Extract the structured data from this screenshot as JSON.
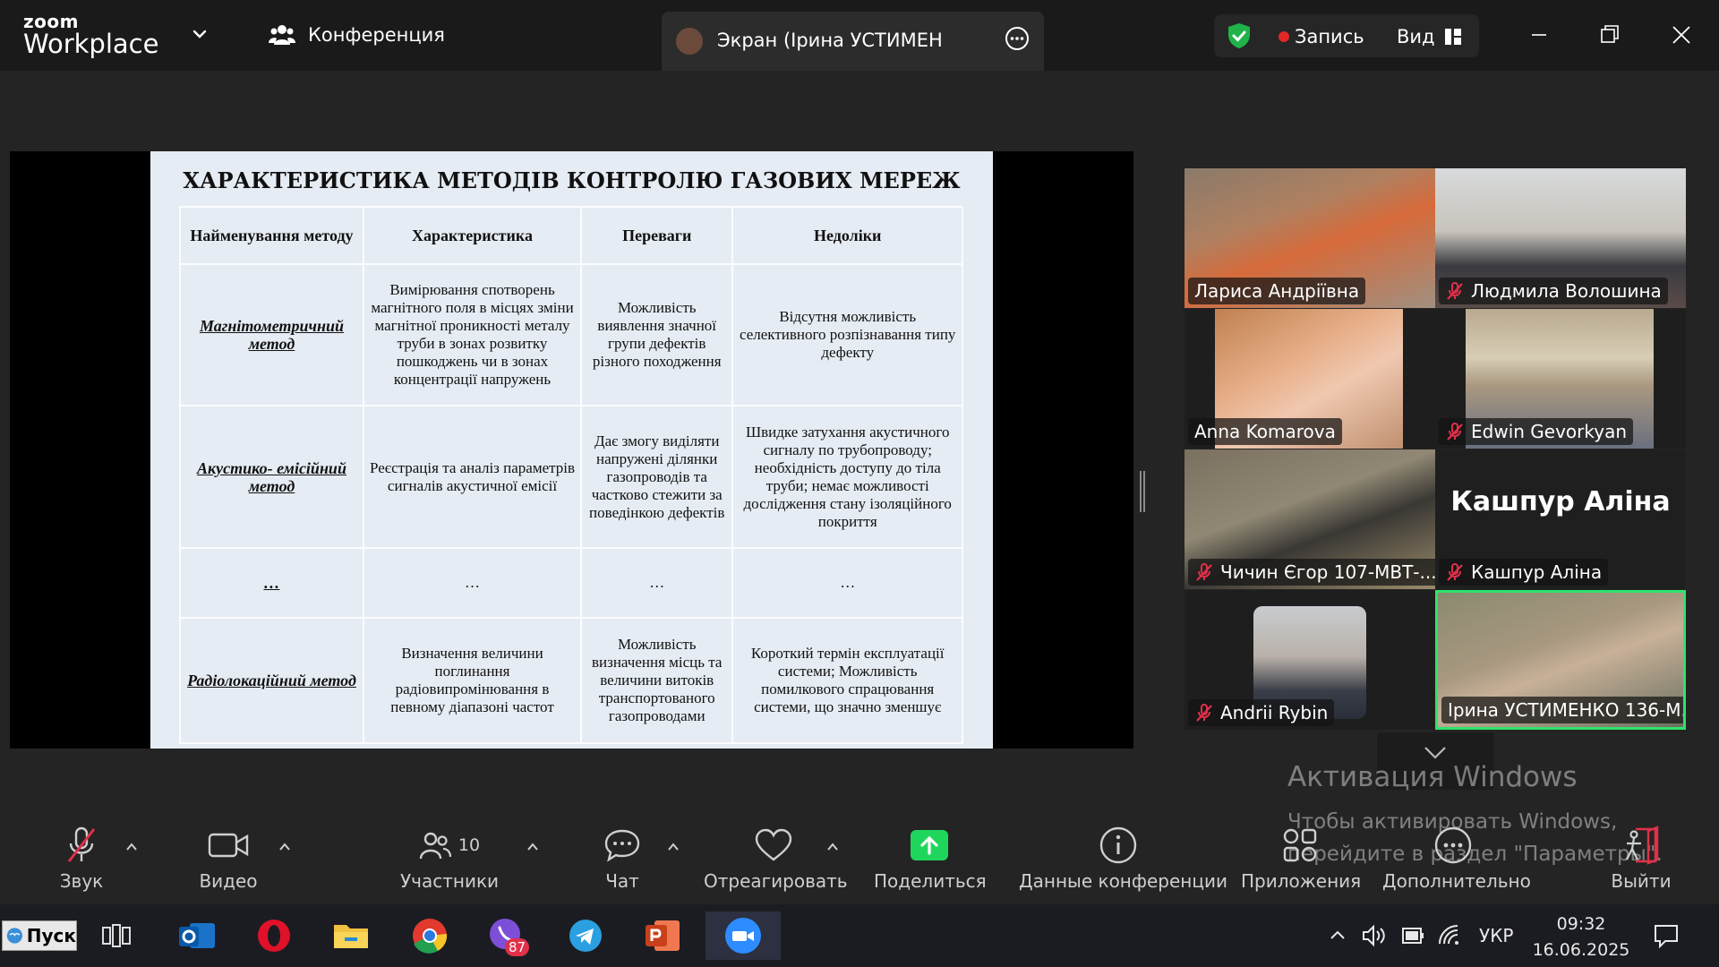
{
  "app": {
    "logo_line1": "zoom",
    "logo_line2": "Workplace"
  },
  "header": {
    "conference_label": "Конференция",
    "screen_tab_title": "Экран (Ірина УСТИМЕНКО 136-М",
    "recording_label": "Запись",
    "view_label": "Вид",
    "recording_color": "#e02828",
    "shield_color": "#1fb34a"
  },
  "slide": {
    "title": "ХАРАКТЕРИСТИКА МЕТОДІВ КОНТРОЛЮ ГАЗОВИХ МЕРЕЖ",
    "headers": [
      "Найменування методу",
      "Характеристика",
      "Переваги",
      "Недоліки"
    ],
    "rows": [
      {
        "name": "Магнітометричний метод",
        "characteristic": "Вимірювання спотворень магнітного поля в місцях зміни магнітної проникності металу труби в зонах розвитку пошкоджень чи в зонах концентрації напружень",
        "advantages": "Можливість виявлення значної групи дефектів різного походження",
        "disadvantages": "Відсутня можливість селективного розпізнавання типу дефекту"
      },
      {
        "name": "Акустико- емісійний метод",
        "characteristic": "Реєстрація та аналіз параметрів сигналів акустичної емісії",
        "advantages": "Дає змогу виділяти напружені ділянки газопроводів та частково стежити за поведінкою дефектів",
        "disadvantages": "Швидке затухання акустичного сигналу по трубопроводу; необхідність доступу до тіла труби; немає можливості дослідження стану ізоляційного покриття"
      },
      {
        "name": "…",
        "characteristic": "…",
        "advantages": "…",
        "disadvantages": "…"
      },
      {
        "name": "Радіолокаційний метод",
        "characteristic": "Визначення величини поглинання радіовипромінювання в певному діапазоні частот",
        "advantages": "Можливість визначення місць та величини витоків транспортованого газопроводами",
        "disadvantages": "Короткий термін експлуатації системи; Можливість помилкового спрацювання системи, що значно зменшує"
      }
    ]
  },
  "participants": [
    {
      "name": "Лариса Андріївна",
      "muted": false,
      "active": false,
      "has_video": true
    },
    {
      "name": "Людмила Волошина",
      "muted": true,
      "active": false,
      "has_video": true
    },
    {
      "name": "Anna Komarova",
      "muted": false,
      "active": false,
      "has_video": true
    },
    {
      "name": "Edwin Gevorkyan",
      "muted": true,
      "active": false,
      "has_video": true
    },
    {
      "name": "Чичин Єгор 107-МВТ-...",
      "muted": true,
      "active": false,
      "has_video": true
    },
    {
      "name": "Кашпур Аліна",
      "muted": true,
      "active": false,
      "has_video": false,
      "big_label": "Кашпур Аліна"
    },
    {
      "name": "Andrii Rybin",
      "muted": true,
      "active": false,
      "has_video": true
    },
    {
      "name": "Ірина УСТИМЕНКО 136-М...",
      "muted": false,
      "active": true,
      "has_video": true
    }
  ],
  "watermark": {
    "line1": "Активация Windows",
    "line2": "Чтобы активировать Windows,",
    "line3": "перейдите в раздел \"Параметры\"."
  },
  "toolbar": {
    "audio": "Звук",
    "video": "Видео",
    "participants": "Участники",
    "participants_count": "10",
    "chat": "Чат",
    "react": "Отреагировать",
    "share": "Поделиться",
    "meeting_info": "Данные конференции",
    "apps": "Приложения",
    "more": "Дополнительно",
    "leave": "Выйти",
    "share_color": "#1fd65c",
    "leave_color": "#e0304a"
  },
  "taskbar": {
    "start_label": "Пуск",
    "viber_badge": "87",
    "language": "УКР",
    "time": "09:32",
    "date": "16.06.2025"
  }
}
